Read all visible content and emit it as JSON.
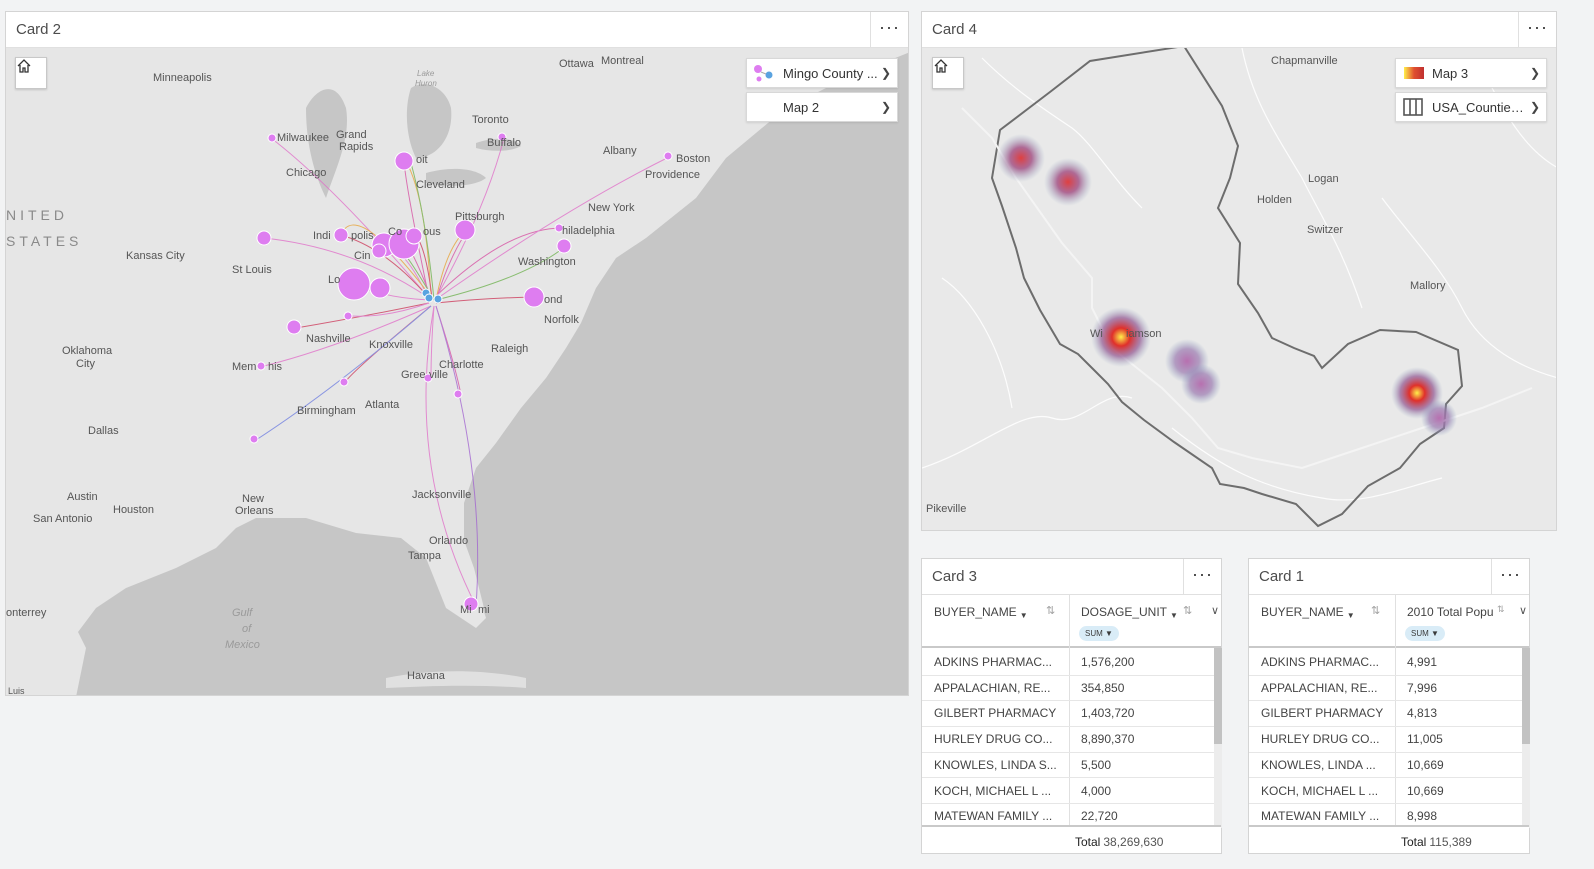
{
  "colors": {
    "card_bg": "#ffffff",
    "page_bg": "#f2f3f4",
    "flow_point_origin": "#5aa3e0",
    "flow_point_dest": "#de7df0",
    "heat_hot": "#ffee44",
    "heat_mid": "#e0302a",
    "boundary": "#6d6d6d",
    "sum_pill": "#d9ecf7"
  },
  "card2": {
    "title": "Card 2",
    "menu": "···",
    "home_icon": "home-icon",
    "legend": [
      {
        "label": "Mingo County ...",
        "icon": "flow-points-icon"
      },
      {
        "label": "Map 2",
        "icon": ""
      }
    ],
    "places": [
      "Minneapolis",
      "Ottawa",
      "Montreal",
      "Lake",
      "Huron",
      "Toronto",
      "Milwaukee",
      "Grand",
      "Rapids",
      "Buffalo",
      "Albany",
      "Boston",
      "Providence",
      "Chicago",
      "oit",
      "Cleveland",
      "New York",
      "NITED",
      "STATES",
      "Pittsburgh",
      "Indi",
      "polis",
      "Co",
      "ous",
      "hiladelphia",
      "Kansas City",
      "St Louis",
      "Cin",
      "Washington",
      "Lo",
      "ond",
      "Norfolk",
      "Oklahoma",
      "City",
      "Nashville",
      "Knoxville",
      "Raleigh",
      "Charlotte",
      "Mem",
      "his",
      "Gree",
      "ville",
      "Atlanta",
      "Birmingham",
      "Dallas",
      "Austin",
      "Houston",
      "San Antonio",
      "New",
      "Orleans",
      "Jacksonville",
      "Orlando",
      "Tampa",
      "Gulf",
      "of",
      "Mexico",
      "onterrey",
      "Mi",
      "mi",
      "Havana",
      "Luis"
    ]
  },
  "card4": {
    "title": "Card 4",
    "menu": "···",
    "home_icon": "home-icon",
    "legend": [
      {
        "label": "Map 3",
        "icon": "heatmap-gradient-icon"
      },
      {
        "label": "USA_Counties...",
        "icon": "boundary-columns-icon"
      }
    ],
    "places": [
      "Chapmanville",
      "Holden",
      "Logan",
      "Switzer",
      "Mallory",
      "Wi",
      "iamson",
      "Pikeville"
    ]
  },
  "card3": {
    "title": "Card 3",
    "menu": "···",
    "col1_header": "BUYER_NAME",
    "col2_header": "DOSAGE_UNIT",
    "sum_label": "SUM",
    "rows": [
      {
        "name": "ADKINS PHARMAC...",
        "value": "1,576,200"
      },
      {
        "name": "APPALACHIAN, RE...",
        "value": "354,850"
      },
      {
        "name": "GILBERT PHARMACY",
        "value": "1,403,720"
      },
      {
        "name": "HURLEY DRUG CO...",
        "value": "8,890,370"
      },
      {
        "name": "KNOWLES, LINDA S...",
        "value": "5,500"
      },
      {
        "name": "KOCH, MICHAEL L ...",
        "value": "4,000"
      },
      {
        "name": "MATEWAN FAMILY ...",
        "value": "22,720"
      }
    ],
    "total_label": "Total",
    "total_value": "38,269,630"
  },
  "card1": {
    "title": "Card 1",
    "menu": "···",
    "col1_header": "BUYER_NAME",
    "col2_header": "2010 Total Popu",
    "sum_label": "SUM",
    "rows": [
      {
        "name": "ADKINS PHARMAC...",
        "value": "4,991"
      },
      {
        "name": "APPALACHIAN, RE...",
        "value": "7,996"
      },
      {
        "name": "GILBERT PHARMACY",
        "value": "4,813"
      },
      {
        "name": "HURLEY DRUG CO...",
        "value": "11,005"
      },
      {
        "name": "KNOWLES, LINDA ...",
        "value": "10,669"
      },
      {
        "name": "KOCH, MICHAEL L ...",
        "value": "10,669"
      },
      {
        "name": "MATEWAN FAMILY ...",
        "value": "8,998"
      }
    ],
    "total_label": "Total",
    "total_value": "115,389"
  }
}
